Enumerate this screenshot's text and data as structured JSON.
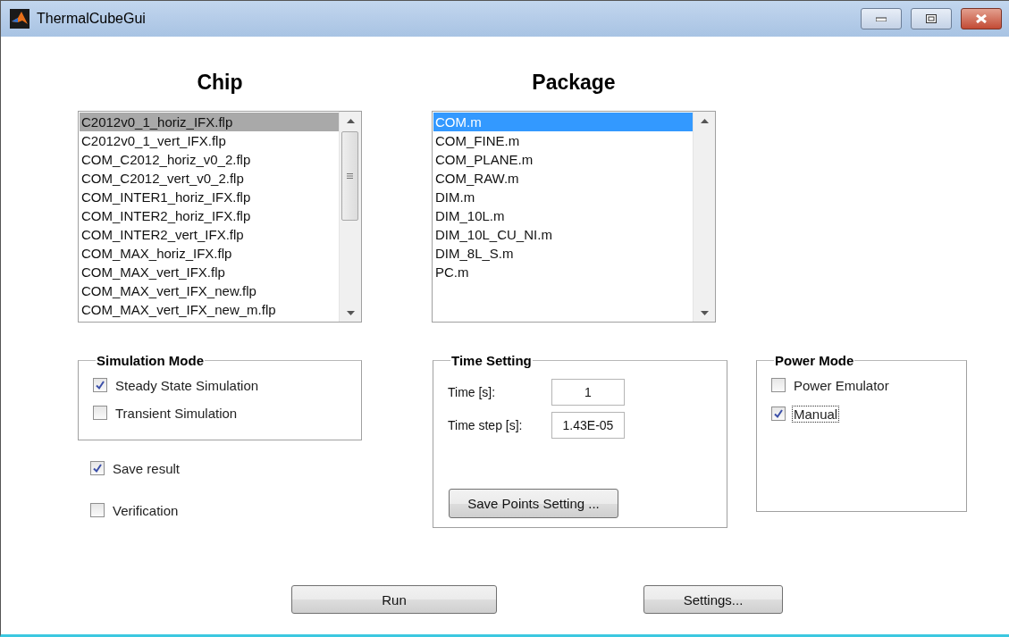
{
  "window": {
    "title": "ThermalCubeGui"
  },
  "chip": {
    "heading": "Chip",
    "active": false,
    "items": [
      {
        "label": "C2012v0_1_horiz_IFX.flp",
        "selected": true
      },
      {
        "label": "C2012v0_1_vert_IFX.flp",
        "selected": false
      },
      {
        "label": "COM_C2012_horiz_v0_2.flp",
        "selected": false
      },
      {
        "label": "COM_C2012_vert_v0_2.flp",
        "selected": false
      },
      {
        "label": "COM_INTER1_horiz_IFX.flp",
        "selected": false
      },
      {
        "label": "COM_INTER2_horiz_IFX.flp",
        "selected": false
      },
      {
        "label": "COM_INTER2_vert_IFX.flp",
        "selected": false
      },
      {
        "label": "COM_MAX_horiz_IFX.flp",
        "selected": false
      },
      {
        "label": "COM_MAX_vert_IFX.flp",
        "selected": false
      },
      {
        "label": "COM_MAX_vert_IFX_new.flp",
        "selected": false
      },
      {
        "label": "COM_MAX_vert_IFX_new_m.flp",
        "selected": false
      }
    ]
  },
  "package": {
    "heading": "Package",
    "active": true,
    "items": [
      {
        "label": "COM.m",
        "selected": true
      },
      {
        "label": "COM_FINE.m",
        "selected": false
      },
      {
        "label": "COM_PLANE.m",
        "selected": false
      },
      {
        "label": "COM_RAW.m",
        "selected": false
      },
      {
        "label": "DIM.m",
        "selected": false
      },
      {
        "label": "DIM_10L.m",
        "selected": false
      },
      {
        "label": "DIM_10L_CU_NI.m",
        "selected": false
      },
      {
        "label": "DIM_8L_S.m",
        "selected": false
      },
      {
        "label": "PC.m",
        "selected": false
      }
    ]
  },
  "simulation_mode": {
    "title": "Simulation Mode",
    "options": [
      {
        "label": "Steady State Simulation",
        "checked": true
      },
      {
        "label": "Transient Simulation",
        "checked": false
      }
    ]
  },
  "extra_options": [
    {
      "label": "Save result",
      "checked": true
    },
    {
      "label": "Verification",
      "checked": false
    }
  ],
  "time_setting": {
    "title": "Time Setting",
    "fields": [
      {
        "label": "Time [s]:",
        "value": "1"
      },
      {
        "label": "Time step [s]:",
        "value": "1.43E-05"
      }
    ],
    "button": "Save Points Setting ..."
  },
  "power_mode": {
    "title": "Power Mode",
    "options": [
      {
        "label": "Power Emulator",
        "checked": false,
        "focused": false
      },
      {
        "label": "Manual",
        "checked": true,
        "focused": true
      }
    ]
  },
  "buttons": [
    "Run",
    "Settings..."
  ]
}
